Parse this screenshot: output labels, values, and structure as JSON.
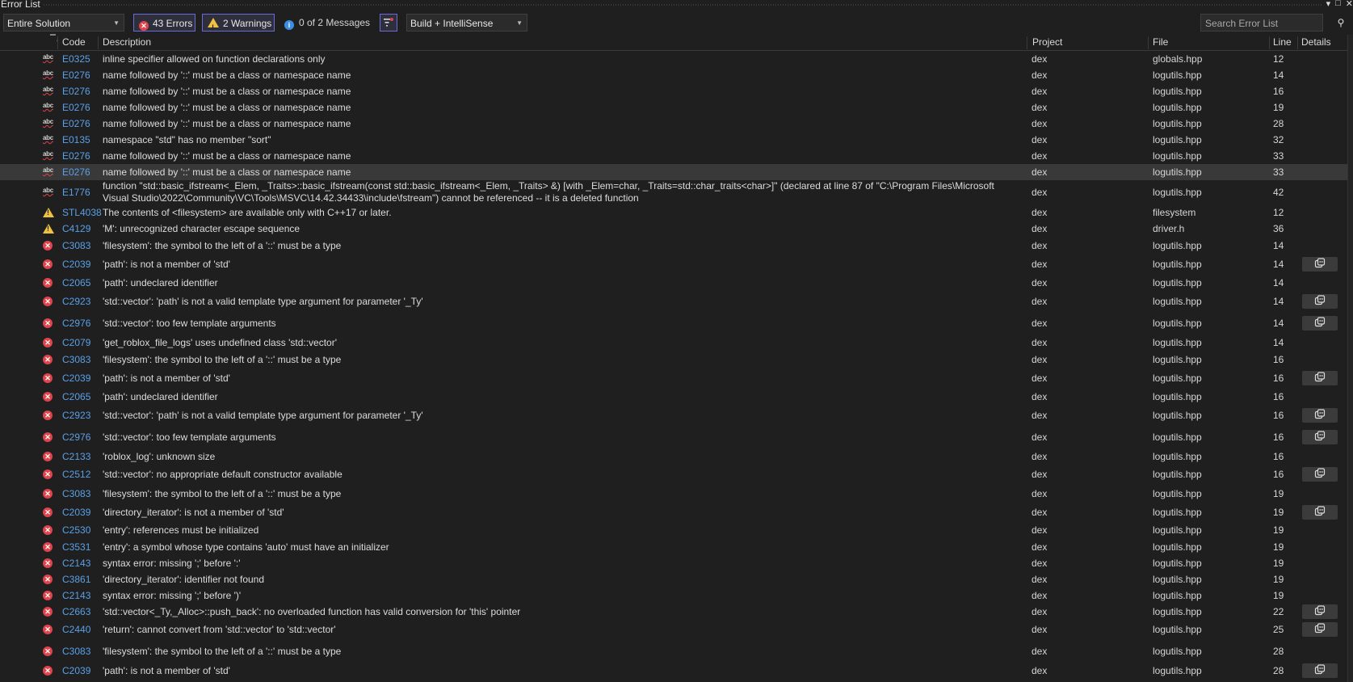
{
  "window": {
    "title": "Error List"
  },
  "toolbar": {
    "scope": "Entire Solution",
    "errors": "43 Errors",
    "warnings": "2 Warnings",
    "messages": "0 of 2 Messages",
    "build": "Build + IntelliSense",
    "search_placeholder": "Search Error List"
  },
  "columns": {
    "code": "Code",
    "description": "Description",
    "project": "Project",
    "file": "File",
    "line": "Line",
    "details": "Details"
  },
  "rows": [
    {
      "icon": "intellisense",
      "code": "E0325",
      "desc": "inline specifier allowed on function declarations only",
      "project": "dex",
      "file": "globals.hpp",
      "line": "12",
      "details": false
    },
    {
      "icon": "intellisense",
      "code": "E0276",
      "desc": "name followed by '::' must be a class or namespace name",
      "project": "dex",
      "file": "logutils.hpp",
      "line": "14",
      "details": false
    },
    {
      "icon": "intellisense",
      "code": "E0276",
      "desc": "name followed by '::' must be a class or namespace name",
      "project": "dex",
      "file": "logutils.hpp",
      "line": "16",
      "details": false
    },
    {
      "icon": "intellisense",
      "code": "E0276",
      "desc": "name followed by '::' must be a class or namespace name",
      "project": "dex",
      "file": "logutils.hpp",
      "line": "19",
      "details": false
    },
    {
      "icon": "intellisense",
      "code": "E0276",
      "desc": "name followed by '::' must be a class or namespace name",
      "project": "dex",
      "file": "logutils.hpp",
      "line": "28",
      "details": false
    },
    {
      "icon": "intellisense",
      "code": "E0135",
      "desc": "namespace \"std\" has no member \"sort\"",
      "project": "dex",
      "file": "logutils.hpp",
      "line": "32",
      "details": false
    },
    {
      "icon": "intellisense",
      "code": "E0276",
      "desc": "name followed by '::' must be a class or namespace name",
      "project": "dex",
      "file": "logutils.hpp",
      "line": "33",
      "details": false
    },
    {
      "icon": "intellisense",
      "code": "E0276",
      "desc": "name followed by '::' must be a class or namespace name",
      "project": "dex",
      "file": "logutils.hpp",
      "line": "33",
      "details": false,
      "selected": true
    },
    {
      "icon": "intellisense",
      "code": "E1776",
      "desc": "function \"std::basic_ifstream<_Elem, _Traits>::basic_ifstream(const std::basic_ifstream<_Elem, _Traits> &) [with _Elem=char, _Traits=std::char_traits<char>]\" (declared at line 87 of \"C:\\Program Files\\Microsoft Visual Studio\\2022\\Community\\VC\\Tools\\MSVC\\14.42.34433\\include\\fstream\") cannot be referenced -- it is a deleted function",
      "project": "dex",
      "file": "logutils.hpp",
      "line": "42",
      "details": false,
      "tall": true
    },
    {
      "icon": "warning",
      "code": "STL4038",
      "desc": "The contents of <filesystem> are available only with C++17 or later.",
      "project": "dex",
      "file": "filesystem",
      "line": "12",
      "details": false
    },
    {
      "icon": "warning",
      "code": "C4129",
      "desc": "'M': unrecognized character escape sequence",
      "project": "dex",
      "file": "driver.h",
      "line": "36",
      "details": false
    },
    {
      "icon": "error",
      "code": "C3083",
      "desc": "'filesystem': the symbol to the left of a '::' must be a type",
      "project": "dex",
      "file": "logutils.hpp",
      "line": "14",
      "details": false
    },
    {
      "icon": "error",
      "code": "C2039",
      "desc": "'path': is not a member of 'std'",
      "project": "dex",
      "file": "logutils.hpp",
      "line": "14",
      "details": true
    },
    {
      "icon": "error",
      "code": "C2065",
      "desc": "'path': undeclared identifier",
      "project": "dex",
      "file": "logutils.hpp",
      "line": "14",
      "details": false
    },
    {
      "icon": "error",
      "code": "C2923",
      "desc": "'std::vector': 'path' is not a valid template type argument for parameter '_Ty'",
      "project": "dex",
      "file": "logutils.hpp",
      "line": "14",
      "details": true
    },
    {
      "icon": "error",
      "code": "C2976",
      "desc": "'std::vector': too few template arguments",
      "project": "dex",
      "file": "logutils.hpp",
      "line": "14",
      "details": true
    },
    {
      "icon": "error",
      "code": "C2079",
      "desc": "'get_roblox_file_logs' uses undefined class 'std::vector'",
      "project": "dex",
      "file": "logutils.hpp",
      "line": "14",
      "details": false
    },
    {
      "icon": "error",
      "code": "C3083",
      "desc": "'filesystem': the symbol to the left of a '::' must be a type",
      "project": "dex",
      "file": "logutils.hpp",
      "line": "16",
      "details": false
    },
    {
      "icon": "error",
      "code": "C2039",
      "desc": "'path': is not a member of 'std'",
      "project": "dex",
      "file": "logutils.hpp",
      "line": "16",
      "details": true
    },
    {
      "icon": "error",
      "code": "C2065",
      "desc": "'path': undeclared identifier",
      "project": "dex",
      "file": "logutils.hpp",
      "line": "16",
      "details": false
    },
    {
      "icon": "error",
      "code": "C2923",
      "desc": "'std::vector': 'path' is not a valid template type argument for parameter '_Ty'",
      "project": "dex",
      "file": "logutils.hpp",
      "line": "16",
      "details": true
    },
    {
      "icon": "error",
      "code": "C2976",
      "desc": "'std::vector': too few template arguments",
      "project": "dex",
      "file": "logutils.hpp",
      "line": "16",
      "details": true
    },
    {
      "icon": "error",
      "code": "C2133",
      "desc": "'roblox_log': unknown size",
      "project": "dex",
      "file": "logutils.hpp",
      "line": "16",
      "details": false
    },
    {
      "icon": "error",
      "code": "C2512",
      "desc": "'std::vector': no appropriate default constructor available",
      "project": "dex",
      "file": "logutils.hpp",
      "line": "16",
      "details": true
    },
    {
      "icon": "error",
      "code": "C3083",
      "desc": "'filesystem': the symbol to the left of a '::' must be a type",
      "project": "dex",
      "file": "logutils.hpp",
      "line": "19",
      "details": false
    },
    {
      "icon": "error",
      "code": "C2039",
      "desc": "'directory_iterator': is not a member of 'std'",
      "project": "dex",
      "file": "logutils.hpp",
      "line": "19",
      "details": true
    },
    {
      "icon": "error",
      "code": "C2530",
      "desc": "'entry': references must be initialized",
      "project": "dex",
      "file": "logutils.hpp",
      "line": "19",
      "details": false
    },
    {
      "icon": "error",
      "code": "C3531",
      "desc": "'entry': a symbol whose type contains 'auto' must have an initializer",
      "project": "dex",
      "file": "logutils.hpp",
      "line": "19",
      "details": false
    },
    {
      "icon": "error",
      "code": "C2143",
      "desc": "syntax error: missing ';' before ':'",
      "project": "dex",
      "file": "logutils.hpp",
      "line": "19",
      "details": false
    },
    {
      "icon": "error",
      "code": "C3861",
      "desc": "'directory_iterator': identifier not found",
      "project": "dex",
      "file": "logutils.hpp",
      "line": "19",
      "details": false
    },
    {
      "icon": "error",
      "code": "C2143",
      "desc": "syntax error: missing ';' before ')'",
      "project": "dex",
      "file": "logutils.hpp",
      "line": "19",
      "details": false
    },
    {
      "icon": "error",
      "code": "C2663",
      "desc": "'std::vector<_Ty,_Alloc>::push_back': no overloaded function has valid conversion for 'this' pointer",
      "project": "dex",
      "file": "logutils.hpp",
      "line": "22",
      "details": true
    },
    {
      "icon": "error",
      "code": "C2440",
      "desc": "'return': cannot convert from 'std::vector' to 'std::vector'",
      "project": "dex",
      "file": "logutils.hpp",
      "line": "25",
      "details": true
    },
    {
      "icon": "error",
      "code": "C3083",
      "desc": "'filesystem': the symbol to the left of a '::' must be a type",
      "project": "dex",
      "file": "logutils.hpp",
      "line": "28",
      "details": false
    },
    {
      "icon": "error",
      "code": "C2039",
      "desc": "'path': is not a member of 'std'",
      "project": "dex",
      "file": "logutils.hpp",
      "line": "28",
      "details": true
    }
  ]
}
